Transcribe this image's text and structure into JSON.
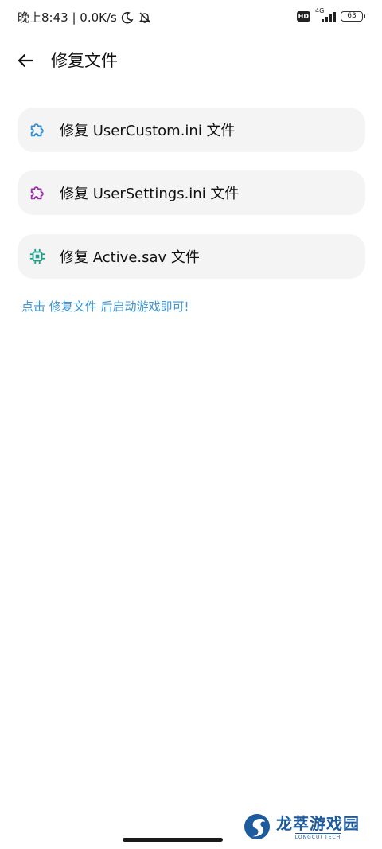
{
  "status_bar": {
    "time_speed": "晚上8:43 | 0.0K/s",
    "hd_badge": "HD",
    "network": "4G",
    "battery": "63"
  },
  "header": {
    "title": "修复文件",
    "back_icon": "arrow-left-icon"
  },
  "actions": [
    {
      "label": "修复 UserCustom.ini 文件",
      "icon": "puzzle-icon",
      "icon_color": "#2f8fd6"
    },
    {
      "label": "修复 UserSettings.ini 文件",
      "icon": "puzzle-icon",
      "icon_color": "#9b2fa8"
    },
    {
      "label": "修复 Active.sav 文件",
      "icon": "chip-icon",
      "icon_color": "#1f9e8a"
    }
  ],
  "hint": "点击 修复文件 后启动游戏即可!",
  "watermark": {
    "title": "龙萃游戏园",
    "subtitle": "LONGCUI TECH"
  },
  "colors": {
    "accent": "#3c97d3",
    "card_bg": "#f4f4f4"
  }
}
